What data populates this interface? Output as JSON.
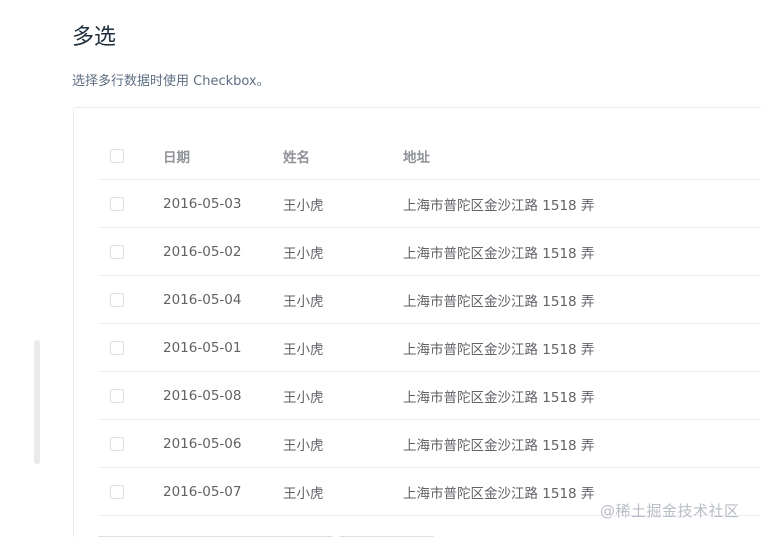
{
  "section": {
    "title": "多选",
    "description": "选择多行数据时使用 Checkbox。"
  },
  "table": {
    "columns": [
      "日期",
      "姓名",
      "地址"
    ],
    "rows": [
      {
        "date": "2016-05-03",
        "name": "王小虎",
        "address": "上海市普陀区金沙江路 1518 弄"
      },
      {
        "date": "2016-05-02",
        "name": "王小虎",
        "address": "上海市普陀区金沙江路 1518 弄"
      },
      {
        "date": "2016-05-04",
        "name": "王小虎",
        "address": "上海市普陀区金沙江路 1518 弄"
      },
      {
        "date": "2016-05-01",
        "name": "王小虎",
        "address": "上海市普陀区金沙江路 1518 弄"
      },
      {
        "date": "2016-05-08",
        "name": "王小虎",
        "address": "上海市普陀区金沙江路 1518 弄"
      },
      {
        "date": "2016-05-06",
        "name": "王小虎",
        "address": "上海市普陀区金沙江路 1518 弄"
      },
      {
        "date": "2016-05-07",
        "name": "王小虎",
        "address": "上海市普陀区金沙江路 1518 弄"
      }
    ]
  },
  "watermark": "@稀土掘金技术社区",
  "colors": {
    "title": "#1f2f3d",
    "header_text": "#909399",
    "body_text": "#606266",
    "border": "#ebeef5",
    "checkbox_border": "#dcdfe6"
  }
}
